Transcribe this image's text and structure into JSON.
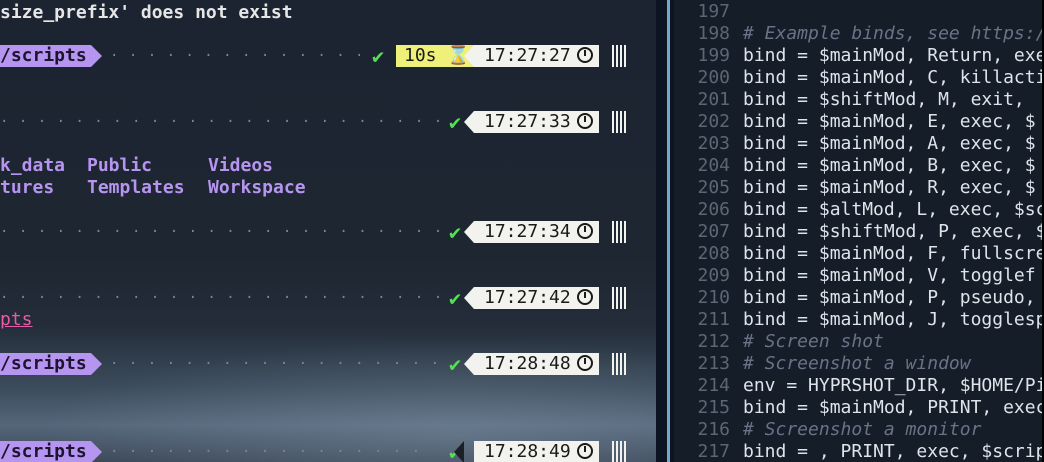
{
  "left_terminal": {
    "error_line": "size_prefix' does not exist",
    "prompts": [
      {
        "path": "/scripts",
        "duration": "10s",
        "time": "17:27:27",
        "has_path": true
      },
      {
        "path": "",
        "duration": "",
        "time": "17:27:33",
        "has_path": false
      },
      {
        "path": "",
        "duration": "",
        "time": "17:27:34",
        "has_path": false
      },
      {
        "path": "",
        "duration": "",
        "time": "17:27:42",
        "has_path": false
      },
      {
        "path": "/scripts",
        "duration": "",
        "time": "17:28:48",
        "has_path": true
      },
      {
        "path": "/scripts",
        "duration": "",
        "time": "17:28:49",
        "has_path": true
      }
    ],
    "ls_output": {
      "row1": [
        "k_data",
        "Public",
        "Videos"
      ],
      "row2": [
        "tures",
        "Templates",
        "Workspace"
      ]
    },
    "link_text": "pts",
    "check_mark": "✔",
    "hourglass": "⌛"
  },
  "right_editor": {
    "lines": [
      {
        "n": "197",
        "text": "",
        "comment": false
      },
      {
        "n": "198",
        "text": "# Example binds, see https:/",
        "comment": true
      },
      {
        "n": "199",
        "text": "bind = $mainMod, Return, exe",
        "comment": false
      },
      {
        "n": "200",
        "text": "bind = $mainMod, C, killacti",
        "comment": false
      },
      {
        "n": "201",
        "text": "bind = $shiftMod, M, exit,",
        "comment": false
      },
      {
        "n": "202",
        "text": "bind = $mainMod, E, exec, $",
        "comment": false
      },
      {
        "n": "203",
        "text": "bind = $mainMod, A, exec, $",
        "comment": false
      },
      {
        "n": "204",
        "text": "bind = $mainMod, B, exec, $",
        "comment": false
      },
      {
        "n": "205",
        "text": "bind = $mainMod, R, exec, $",
        "comment": false
      },
      {
        "n": "206",
        "text": "bind = $altMod, L, exec, $sc",
        "comment": false
      },
      {
        "n": "207",
        "text": "bind = $shiftMod, P, exec, $",
        "comment": false
      },
      {
        "n": "208",
        "text": "bind = $mainMod, F, fullscre",
        "comment": false
      },
      {
        "n": "209",
        "text": "bind = $mainMod, V, togglef",
        "comment": false
      },
      {
        "n": "210",
        "text": "bind = $mainMod, P, pseudo,",
        "comment": false
      },
      {
        "n": "211",
        "text": "bind = $mainMod, J, togglesp",
        "comment": false
      },
      {
        "n": "212",
        "text": "# Screen shot",
        "comment": true
      },
      {
        "n": "213",
        "text": "# Screenshot a window",
        "comment": true
      },
      {
        "n": "214",
        "text": "env = HYPRSHOT_DIR, $HOME/Pi",
        "comment": false
      },
      {
        "n": "215",
        "text": "bind = $mainMod, PRINT, exec",
        "comment": false
      },
      {
        "n": "216",
        "text": "# Screenshot a monitor",
        "comment": true
      },
      {
        "n": "217",
        "text": "bind = , PRINT, exec, $scrip",
        "comment": false
      }
    ]
  }
}
